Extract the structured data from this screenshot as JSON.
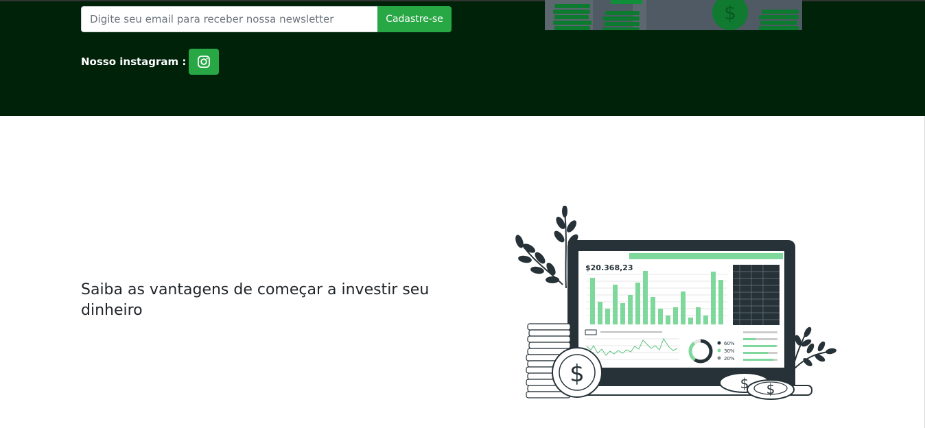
{
  "newsletter": {
    "placeholder": "Digite seu email para receber nossa newsletter",
    "button_label": "Cadastre-se"
  },
  "instagram": {
    "label": "Nosso instagram :",
    "icon": "instagram-icon"
  },
  "section": {
    "headline": "Saiba as vantagens de começar a investir seu dinheiro"
  },
  "illustration": {
    "balance": "$20.368,23",
    "legend": [
      "60%",
      "30%",
      "20%"
    ]
  },
  "colors": {
    "hero_bg": "#002209",
    "accent": "#28a745",
    "chart_green": "#7ed79b",
    "dark": "#263238"
  }
}
